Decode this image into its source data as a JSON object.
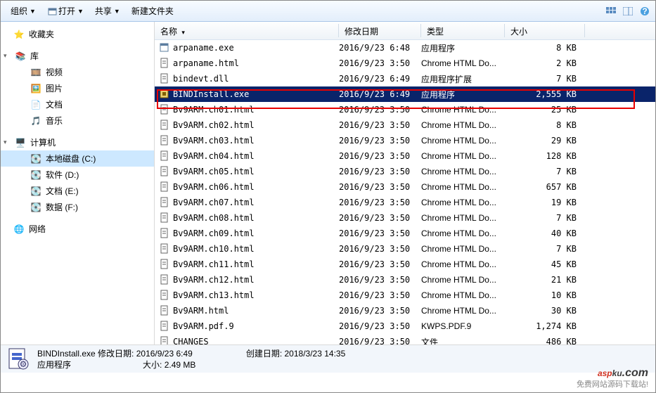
{
  "toolbar": {
    "organize": "组织",
    "open": "打开",
    "share": "共享",
    "newfolder": "新建文件夹"
  },
  "sidebar": {
    "favorites": "收藏夹",
    "library": "库",
    "lib_items": [
      "视频",
      "图片",
      "文档",
      "音乐"
    ],
    "computer": "计算机",
    "drives": [
      "本地磁盘 (C:)",
      "软件 (D:)",
      "文档 (E:)",
      "数据 (F:)"
    ],
    "network": "网络"
  },
  "columns": {
    "name": "名称",
    "date": "修改日期",
    "type": "类型",
    "size": "大小"
  },
  "files": [
    {
      "ico": "app",
      "name": "arpaname.exe",
      "date": "2016/9/23 6:48",
      "type": "应用程序",
      "size": "8 KB"
    },
    {
      "ico": "htm",
      "name": "arpaname.html",
      "date": "2016/9/23 3:50",
      "type": "Chrome HTML Do...",
      "size": "2 KB"
    },
    {
      "ico": "dll",
      "name": "bindevt.dll",
      "date": "2016/9/23 6:49",
      "type": "应用程序扩展",
      "size": "7 KB"
    },
    {
      "ico": "inst",
      "name": "BINDInstall.exe",
      "date": "2016/9/23 6:49",
      "type": "应用程序",
      "size": "2,555 KB",
      "sel": true
    },
    {
      "ico": "htm",
      "name": "Bv9ARM.ch01.html",
      "date": "2016/9/23 3:50",
      "type": "Chrome HTML Do...",
      "size": "25 KB"
    },
    {
      "ico": "htm",
      "name": "Bv9ARM.ch02.html",
      "date": "2016/9/23 3:50",
      "type": "Chrome HTML Do...",
      "size": "8 KB"
    },
    {
      "ico": "htm",
      "name": "Bv9ARM.ch03.html",
      "date": "2016/9/23 3:50",
      "type": "Chrome HTML Do...",
      "size": "29 KB"
    },
    {
      "ico": "htm",
      "name": "Bv9ARM.ch04.html",
      "date": "2016/9/23 3:50",
      "type": "Chrome HTML Do...",
      "size": "128 KB"
    },
    {
      "ico": "htm",
      "name": "Bv9ARM.ch05.html",
      "date": "2016/9/23 3:50",
      "type": "Chrome HTML Do...",
      "size": "7 KB"
    },
    {
      "ico": "htm",
      "name": "Bv9ARM.ch06.html",
      "date": "2016/9/23 3:50",
      "type": "Chrome HTML Do...",
      "size": "657 KB"
    },
    {
      "ico": "htm",
      "name": "Bv9ARM.ch07.html",
      "date": "2016/9/23 3:50",
      "type": "Chrome HTML Do...",
      "size": "19 KB"
    },
    {
      "ico": "htm",
      "name": "Bv9ARM.ch08.html",
      "date": "2016/9/23 3:50",
      "type": "Chrome HTML Do...",
      "size": "7 KB"
    },
    {
      "ico": "htm",
      "name": "Bv9ARM.ch09.html",
      "date": "2016/9/23 3:50",
      "type": "Chrome HTML Do...",
      "size": "40 KB"
    },
    {
      "ico": "htm",
      "name": "Bv9ARM.ch10.html",
      "date": "2016/9/23 3:50",
      "type": "Chrome HTML Do...",
      "size": "7 KB"
    },
    {
      "ico": "htm",
      "name": "Bv9ARM.ch11.html",
      "date": "2016/9/23 3:50",
      "type": "Chrome HTML Do...",
      "size": "45 KB"
    },
    {
      "ico": "htm",
      "name": "Bv9ARM.ch12.html",
      "date": "2016/9/23 3:50",
      "type": "Chrome HTML Do...",
      "size": "21 KB"
    },
    {
      "ico": "htm",
      "name": "Bv9ARM.ch13.html",
      "date": "2016/9/23 3:50",
      "type": "Chrome HTML Do...",
      "size": "10 KB"
    },
    {
      "ico": "htm",
      "name": "Bv9ARM.html",
      "date": "2016/9/23 3:50",
      "type": "Chrome HTML Do...",
      "size": "30 KB"
    },
    {
      "ico": "pdf",
      "name": "Bv9ARM.pdf.9",
      "date": "2016/9/23 3:50",
      "type": "KWPS.PDF.9",
      "size": "1,274 KB"
    },
    {
      "ico": "file",
      "name": "CHANGES",
      "date": "2016/9/23 3:50",
      "type": "文件",
      "size": "486 KB"
    }
  ],
  "status": {
    "filename": "BINDInstall.exe",
    "modlabel": "修改日期:",
    "moddate": "2016/9/23 6:49",
    "createlabel": "创建日期:",
    "createdate": "2018/3/23 14:35",
    "type": "应用程序",
    "sizelabel": "大小:",
    "size": "2.49 MB"
  },
  "brand": {
    "a": "asp",
    "b": "ku",
    "c": ".com",
    "sub": "免费网站源码下载站!"
  }
}
